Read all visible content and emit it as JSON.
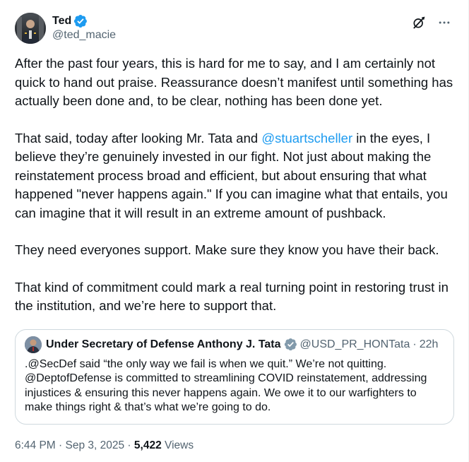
{
  "author": {
    "display_name": "Ted",
    "handle": "@ted_macie",
    "verified": true,
    "verified_color": "#1d9bf0"
  },
  "actions": {
    "grok_icon": "grok-icon",
    "more_icon": "more-icon"
  },
  "tweet": {
    "paragraph_1": "After the past four years, this is hard for me to say, and I am certainly not quick to hand out praise. Reassurance doesn’t manifest until something has actually been done and, to be clear, nothing has been done yet.",
    "paragraph_2_before": "That said, today after looking Mr. Tata and ",
    "paragraph_2_mention": "@stuartscheller",
    "paragraph_2_after": " in the eyes, I believe they’re genuinely invested in our fight. Not just about making the reinstatement process broad and efficient, but about ensuring that what happened \"never happens again.\" If you can imagine what that entails, you can imagine that it will result in an extreme amount of pushback.",
    "paragraph_3": "They need everyones support. Make sure they know you have their back.",
    "paragraph_4": "That kind of commitment could mark a real turning point in restoring trust in the institution, and we’re here to support that."
  },
  "quote": {
    "display_name": "Under Secretary of Defense Anthony J. Tata",
    "verified": true,
    "verified_color": "#829aab",
    "handle": "@USD_PR_HONTata",
    "separator": "·",
    "time": "22h",
    "text": ".@SecDef said “the only way we fail is when we quit.” We’re not quitting. @DeptofDefense is committed to streamlining COVID reinstatement, addressing injustices & ensuring this never happens again. We owe it to our warfighters to make things right & that’s what we’re going to do."
  },
  "footer": {
    "time": "6:44 PM",
    "separator_1": " · ",
    "date": "Sep 3, 2025",
    "separator_2": " · ",
    "views_count": "5,422",
    "views_label": " Views"
  },
  "colors": {
    "text": "#0f1419",
    "secondary": "#536471",
    "link": "#1d9bf0",
    "border": "#cfd9de"
  }
}
